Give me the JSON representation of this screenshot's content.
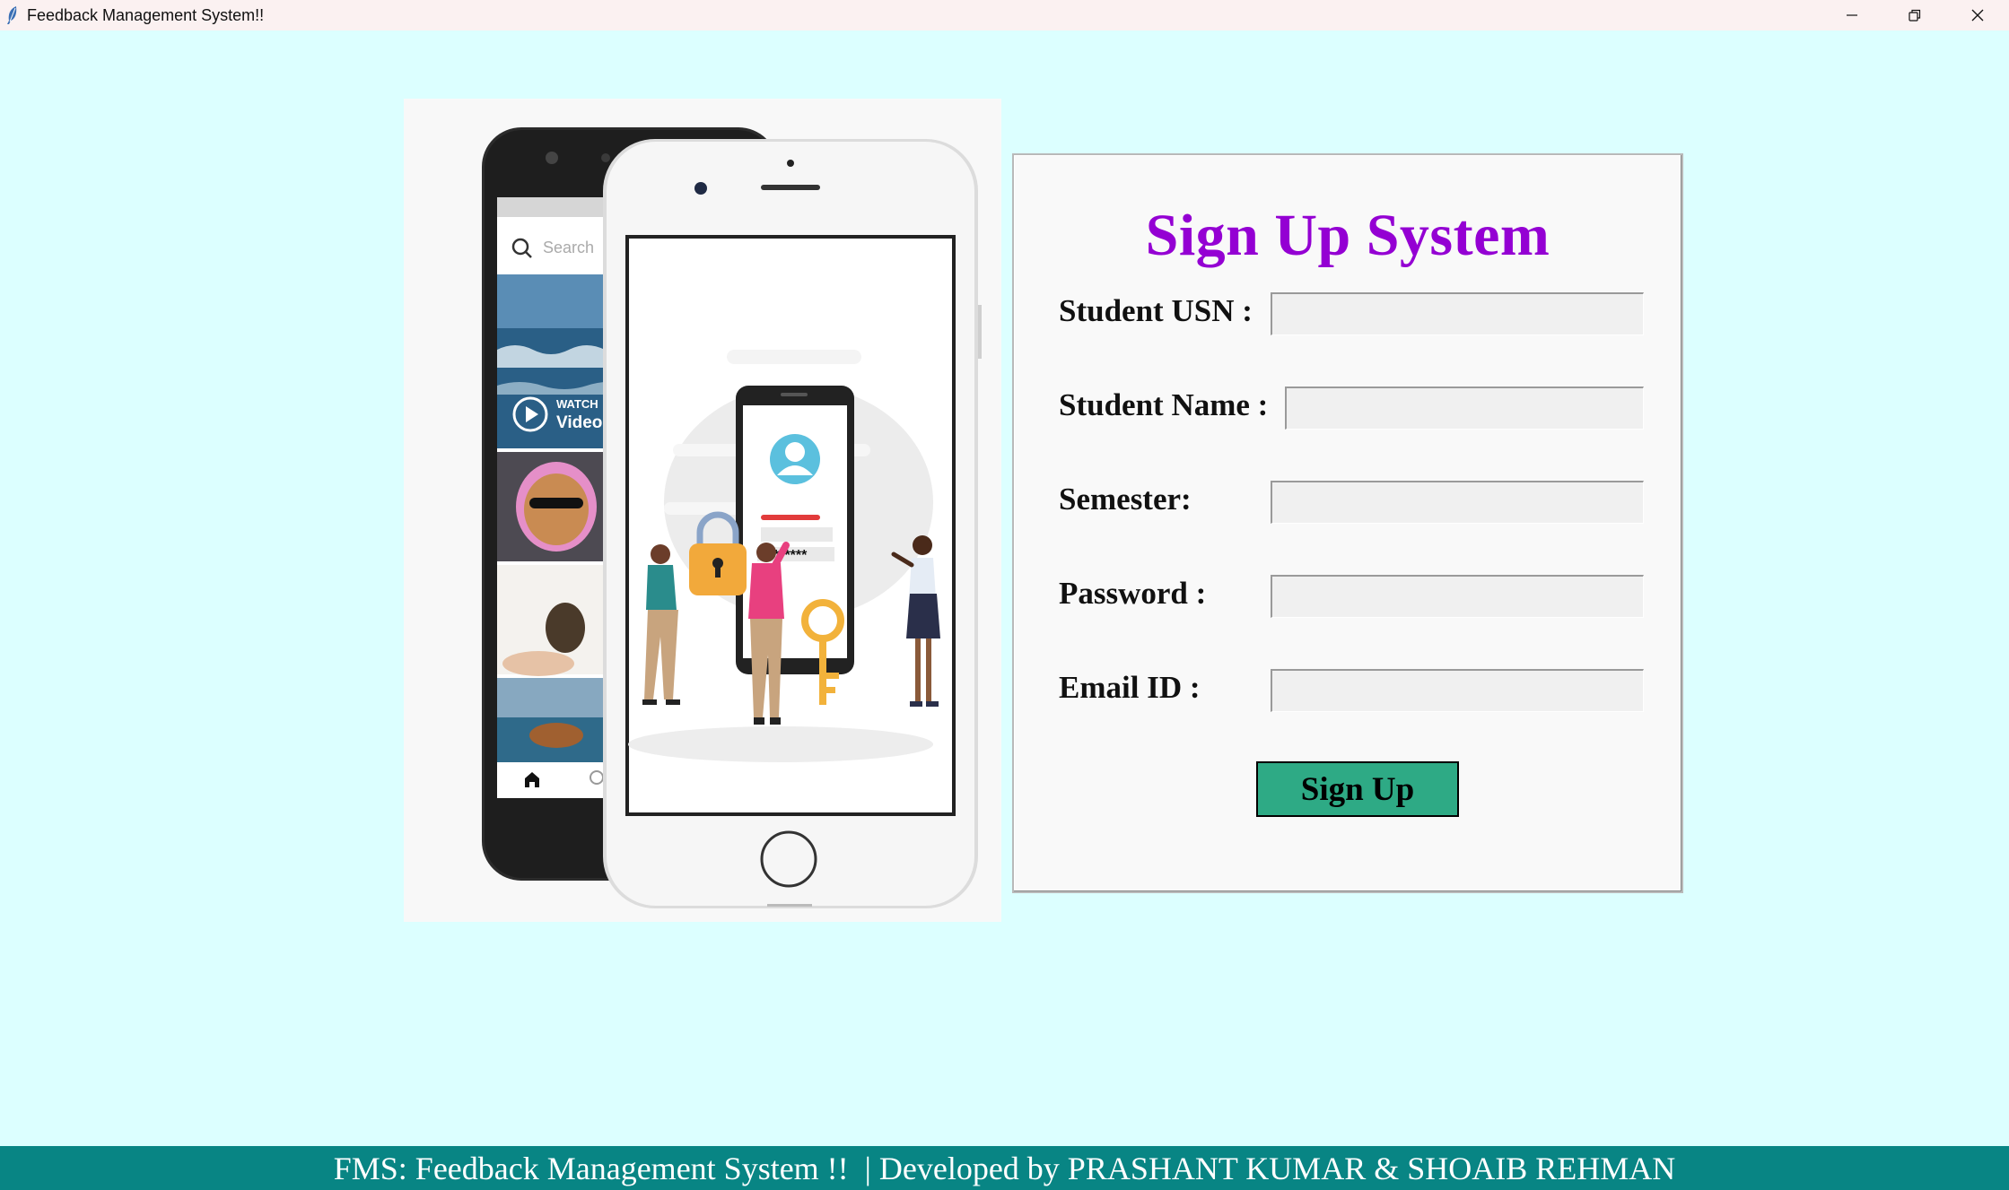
{
  "window": {
    "title": "Feedback Management System!!",
    "controls": [
      "minimize-icon",
      "restore-icon",
      "close-icon"
    ]
  },
  "illustration": {
    "search_placeholder": "Search",
    "watch_text": "WATCH",
    "video_text": "Video",
    "password_mask": "******"
  },
  "form": {
    "heading": "Sign Up System",
    "fields": [
      {
        "label": "Student USN :",
        "value": ""
      },
      {
        "label": "Student Name :",
        "value": ""
      },
      {
        "label": "Semester:",
        "value": ""
      },
      {
        "label": "Password :",
        "value": ""
      },
      {
        "label": "Email ID :",
        "value": ""
      }
    ],
    "submit_label": "Sign Up"
  },
  "footer": {
    "text": "FMS: Feedback Management System !!  | Developed by PRASHANT KUMAR & SHOAIB REHMAN"
  },
  "colors": {
    "background": "#dcffff",
    "heading": "#9400d3",
    "button": "#2eaa85",
    "footer": "#088584"
  }
}
